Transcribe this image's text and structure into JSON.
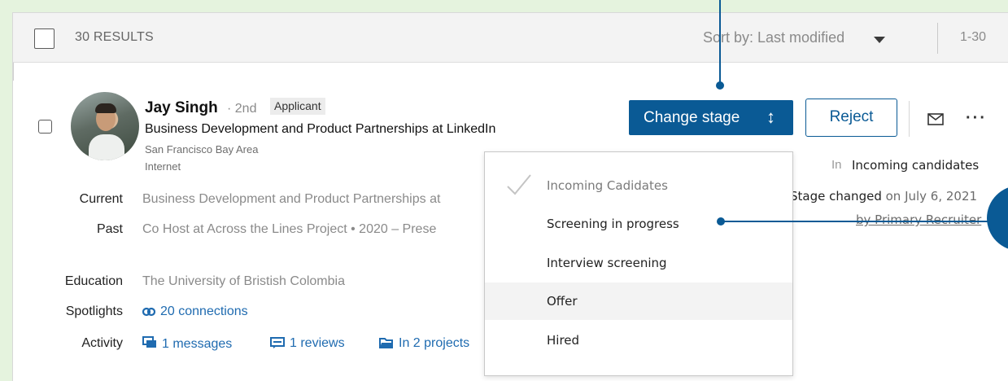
{
  "header": {
    "results_label": "30 RESULTS",
    "sort_label": "Sort by: Last modified",
    "paging": "1-30"
  },
  "candidate": {
    "name": "Jay Singh",
    "degree": "· 2nd",
    "badge": "Applicant",
    "headline": "Business Development and Product Partnerships at LinkedIn",
    "location": "San Francisco Bay Area",
    "industry": "Internet",
    "details": {
      "current_label": "Current",
      "current_value": "Business Development and Product Partnerships at",
      "past_label": "Past",
      "past_value": "Co Host at Across the Lines Project  •  2020 – Prese",
      "education_label": "Education",
      "education_value": "The University of Bristish Colombia",
      "spotlights_label": "Spotlights",
      "spotlights_value": "20 connections",
      "activity_label": "Activity",
      "activity_messages": "1 messages",
      "activity_reviews": "1 reviews",
      "activity_projects": "In 2 projects"
    }
  },
  "actions": {
    "change_stage": "Change stage",
    "change_stage_icon": "↕",
    "reject": "Reject",
    "more": "···"
  },
  "stage": {
    "in_prefix": "In",
    "current_stage": "Incoming candidates",
    "changed_label": "Stage changed",
    "changed_date": " on July 6, 2021",
    "by": "by Primary Recruiter"
  },
  "dropdown": {
    "items": [
      "Incoming Cadidates",
      "Screening in progress",
      "Interview screening",
      "Offer",
      "Hired"
    ]
  },
  "colors": {
    "background": "#e5f3de",
    "primary": "#0a5a95",
    "link": "#1f6bb0"
  }
}
